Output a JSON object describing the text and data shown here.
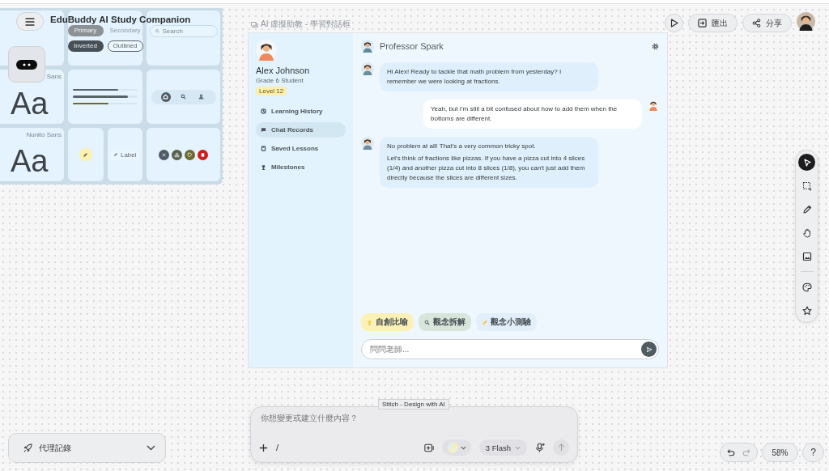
{
  "app": {
    "title": "EduBuddy AI Study Companion"
  },
  "top_bar": {
    "buttons": [
      {
        "label": "匯出"
      },
      {
        "label": "分享"
      }
    ]
  },
  "design_preview": {
    "type_samples": [
      {
        "label": "Sans",
        "sample": "Aa"
      },
      {
        "label": "Nunito Sans",
        "sample": "Aa"
      }
    ],
    "buttons": [
      {
        "label": "Primary",
        "kind": "primary"
      },
      {
        "label": "Secondary",
        "kind": "secondary"
      },
      {
        "label": "Inverted",
        "kind": "inverted"
      },
      {
        "label": "Outlined",
        "kind": "outlined"
      }
    ],
    "search": {
      "placeholder": "Search"
    },
    "progress_bars": [
      {
        "level": 0.7,
        "color": "#58646c"
      },
      {
        "level": 0.85,
        "color": "#58646c"
      },
      {
        "level": 0.55,
        "color": "#6b6a33"
      }
    ],
    "nav_icons": [
      {
        "selected": true
      },
      {
        "selected": false
      },
      {
        "selected": false
      }
    ],
    "chip": {
      "label": "Label"
    },
    "icon_buttons": [
      {
        "color": "#4f5b63"
      },
      {
        "color": "#56604f"
      },
      {
        "color": "#6d6a32"
      },
      {
        "color": "#d01c1c"
      }
    ]
  },
  "frame": {
    "label": "AI 虛擬助教 - 學習對話框",
    "profile": {
      "name": "Alex Johnson",
      "grade": "Grade 6 Student",
      "level_badge": "Level 12"
    },
    "nav": [
      {
        "label": "Learning History",
        "selected": false
      },
      {
        "label": "Chat Records",
        "selected": true
      },
      {
        "label": "Saved Lessons",
        "selected": false
      },
      {
        "label": "Milestones",
        "selected": false
      }
    ],
    "chat": {
      "title": "Professor Spark",
      "messages": [
        {
          "kind": "tutor",
          "paragraphs": [
            "Hi Alex! Ready to tackle that math problem from yesterday? I remember we were looking at fractions."
          ]
        },
        {
          "kind": "student",
          "paragraphs": [
            "Yeah, but I'm still a bit confused about how to add them when the bottoms are different."
          ]
        },
        {
          "kind": "tutor",
          "paragraphs": [
            "No problem at all! That's a very common tricky spot.",
            "Let's think of fractions like pizzas. If you have a pizza cut into 4 slices (1/4) and another pizza cut into 8 slices (1/8), you can't just add them directly because the slices are different sizes."
          ]
        }
      ],
      "suggestions": [
        {
          "label": "自創比喻",
          "color": "#fbf0b5"
        },
        {
          "label": "觀念拆解",
          "color": "#d8e5da"
        },
        {
          "label": "觀念小測驗",
          "color": "#e2eefa"
        }
      ],
      "input": {
        "placeholder": "問問老師..."
      }
    }
  },
  "prompt": {
    "tooltip": "Stitch - Design with AI",
    "placeholder": "你想變更或建立什麼內容？",
    "slash": "/",
    "model": "3 Flash"
  },
  "agent_log": {
    "label": "代理記錄",
    "expanded": false
  },
  "tools": [
    {
      "selected": true
    },
    {
      "selected": false
    },
    {
      "selected": false
    },
    {
      "selected": false
    },
    {
      "selected": false
    },
    {
      "selected": false
    },
    {
      "selected": false
    }
  ],
  "zoom_text": "58%",
  "help": "?"
}
